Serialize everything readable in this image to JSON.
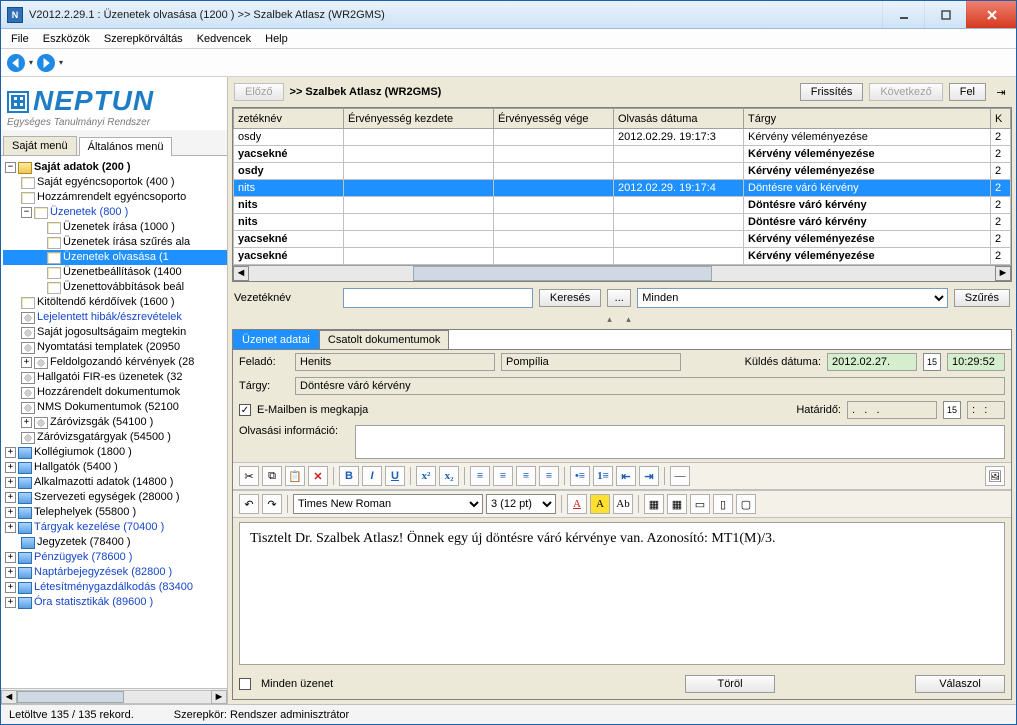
{
  "title": "V2012.2.29.1 : Üzenetek olvasása (1200  )  >> Szalbek Atlasz (WR2GMS)",
  "menu": [
    "File",
    "Eszközök",
    "Szerepkörváltás",
    "Kedvencek",
    "Help"
  ],
  "logo": {
    "big": "NEPTUN",
    "sub": "Egységes Tanulmányi Rendszer"
  },
  "lefttabs": {
    "t1": "Saját menü",
    "t2": "Általános menü"
  },
  "tree": {
    "root": "Saját adatok (200  )",
    "n1": "Saját egyéncsoportok (400  )",
    "n2": "Hozzámrendelt egyéncsoporto",
    "n3": "Üzenetek (800  )",
    "n3a": "Üzenetek írása (1000  )",
    "n3b": "Üzenetek írása szűrés ala",
    "n3c": "Üzenetek olvasása (1",
    "n3d": "Üzenetbeállítások (1400",
    "n3e": "Üzenettovábbítások beál",
    "n4": "Kitöltendő kérdőívek (1600  )",
    "n5": "Lejelentett hibák/észrevételek",
    "n6": "Saját jogosultságaim megtekin",
    "n7": "Nyomtatási templatek (20950",
    "n8": "Feldolgozandó kérvények (28",
    "n9": "Hallgatói FIR-es üzenetek (32",
    "n10": "Hozzárendelt dokumentumok",
    "n11": "NMS Dokumentumok (52100",
    "n12": "Záróvizsgák (54100  )",
    "n13": "Záróvizsgatárgyak (54500  )",
    "n14": "Kollégiumok (1800  )",
    "n15": "Hallgatók (5400  )",
    "n16": "Alkalmazotti adatok (14800  )",
    "n17": "Szervezeti egységek (28000  )",
    "n18": "Telephelyek (55800  )",
    "n19": "Tárgyak kezelése (70400  )",
    "n20": "Jegyzetek (78400  )",
    "n21": "Pénzügyek (78600  )",
    "n22": "Naptárbejegyzések (82800  )",
    "n23": "Létesítménygazdálkodás (83400",
    "n24": "Óra statisztikák (89600  )"
  },
  "header": {
    "prev": "Előző",
    "crumb": ">>  Szalbek Atlasz (WR2GMS)",
    "refresh": "Frissítés",
    "next": "Következő",
    "up": "Fel"
  },
  "grid": {
    "cols": {
      "c1": "zetéknév",
      "c2": "Érvényesség kezdete",
      "c3": "Érvényesség vége",
      "c4": "Olvasás dátuma",
      "c5": "Tárgy",
      "c6": "K"
    },
    "rows": [
      {
        "c1": "osdy",
        "c4": "2012.02.29. 19:17:3",
        "c5": "Kérvény véleményezése",
        "c6": "2",
        "bold": false
      },
      {
        "c1": "yacsekné",
        "c4": "",
        "c5": "Kérvény véleményezése",
        "c6": "2",
        "bold": true
      },
      {
        "c1": "osdy",
        "c4": "",
        "c5": "Kérvény véleményezése",
        "c6": "2",
        "bold": true
      },
      {
        "c1": "nits",
        "c4": "2012.02.29. 19:17:4",
        "c5": "Döntésre váró kérvény",
        "c6": "2",
        "sel": true
      },
      {
        "c1": "nits",
        "c4": "",
        "c5": "Döntésre váró kérvény",
        "c6": "2",
        "bold": true
      },
      {
        "c1": "nits",
        "c4": "",
        "c5": "Döntésre váró kérvény",
        "c6": "2",
        "bold": true
      },
      {
        "c1": "yacsekné",
        "c4": "",
        "c5": "Kérvény véleményezése",
        "c6": "2",
        "bold": true
      },
      {
        "c1": "yacsekné",
        "c4": "",
        "c5": "Kérvény véleményezése",
        "c6": "2",
        "bold": true
      }
    ]
  },
  "search": {
    "label": "Vezetéknév",
    "btn": "Keresés",
    "dots": "...",
    "all": "Minden",
    "filter": "Szűrés"
  },
  "detail": {
    "tab1": "Üzenet adatai",
    "tab2": "Csatolt dokumentumok",
    "from_lbl": "Feladó:",
    "from1": "Henits",
    "from2": "Pompília",
    "sent_lbl": "Küldés dátuma:",
    "sent_date": "2012.02.27.",
    "sent_time": "10:29:52",
    "subj_lbl": "Tárgy:",
    "subj": "Döntésre váró kérvény",
    "email_lbl": "E-Mailben is megkapja",
    "deadline_lbl": "Határidő:",
    "deadline_date": ".   .   .",
    "deadline_time": ":   :",
    "readinfo_lbl": "Olvasási információ:",
    "font": "Times New Roman",
    "size": "3 (12 pt)",
    "body": "Tisztelt Dr. Szalbek Atlasz! Önnek egy új döntésre váró kérvénye van. Azonosító: MT1(M)/3.",
    "all_msg": "Minden üzenet",
    "delete": "Töröl",
    "reply": "Válaszol"
  },
  "status": {
    "left": "Letöltve 135 / 135 rekord.",
    "mid": "Szerepkör: Rendszer adminisztrátor"
  }
}
